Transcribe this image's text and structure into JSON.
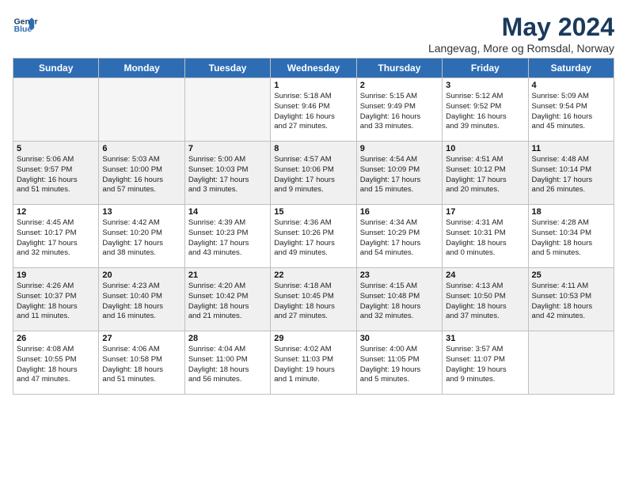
{
  "logo": {
    "line1": "General",
    "line2": "Blue"
  },
  "title": "May 2024",
  "subtitle": "Langevag, More og Romsdal, Norway",
  "days_of_week": [
    "Sunday",
    "Monday",
    "Tuesday",
    "Wednesday",
    "Thursday",
    "Friday",
    "Saturday"
  ],
  "weeks": [
    [
      {
        "num": "",
        "info": ""
      },
      {
        "num": "",
        "info": ""
      },
      {
        "num": "",
        "info": ""
      },
      {
        "num": "1",
        "info": "Sunrise: 5:18 AM\nSunset: 9:46 PM\nDaylight: 16 hours\nand 27 minutes."
      },
      {
        "num": "2",
        "info": "Sunrise: 5:15 AM\nSunset: 9:49 PM\nDaylight: 16 hours\nand 33 minutes."
      },
      {
        "num": "3",
        "info": "Sunrise: 5:12 AM\nSunset: 9:52 PM\nDaylight: 16 hours\nand 39 minutes."
      },
      {
        "num": "4",
        "info": "Sunrise: 5:09 AM\nSunset: 9:54 PM\nDaylight: 16 hours\nand 45 minutes."
      }
    ],
    [
      {
        "num": "5",
        "info": "Sunrise: 5:06 AM\nSunset: 9:57 PM\nDaylight: 16 hours\nand 51 minutes."
      },
      {
        "num": "6",
        "info": "Sunrise: 5:03 AM\nSunset: 10:00 PM\nDaylight: 16 hours\nand 57 minutes."
      },
      {
        "num": "7",
        "info": "Sunrise: 5:00 AM\nSunset: 10:03 PM\nDaylight: 17 hours\nand 3 minutes."
      },
      {
        "num": "8",
        "info": "Sunrise: 4:57 AM\nSunset: 10:06 PM\nDaylight: 17 hours\nand 9 minutes."
      },
      {
        "num": "9",
        "info": "Sunrise: 4:54 AM\nSunset: 10:09 PM\nDaylight: 17 hours\nand 15 minutes."
      },
      {
        "num": "10",
        "info": "Sunrise: 4:51 AM\nSunset: 10:12 PM\nDaylight: 17 hours\nand 20 minutes."
      },
      {
        "num": "11",
        "info": "Sunrise: 4:48 AM\nSunset: 10:14 PM\nDaylight: 17 hours\nand 26 minutes."
      }
    ],
    [
      {
        "num": "12",
        "info": "Sunrise: 4:45 AM\nSunset: 10:17 PM\nDaylight: 17 hours\nand 32 minutes."
      },
      {
        "num": "13",
        "info": "Sunrise: 4:42 AM\nSunset: 10:20 PM\nDaylight: 17 hours\nand 38 minutes."
      },
      {
        "num": "14",
        "info": "Sunrise: 4:39 AM\nSunset: 10:23 PM\nDaylight: 17 hours\nand 43 minutes."
      },
      {
        "num": "15",
        "info": "Sunrise: 4:36 AM\nSunset: 10:26 PM\nDaylight: 17 hours\nand 49 minutes."
      },
      {
        "num": "16",
        "info": "Sunrise: 4:34 AM\nSunset: 10:29 PM\nDaylight: 17 hours\nand 54 minutes."
      },
      {
        "num": "17",
        "info": "Sunrise: 4:31 AM\nSunset: 10:31 PM\nDaylight: 18 hours\nand 0 minutes."
      },
      {
        "num": "18",
        "info": "Sunrise: 4:28 AM\nSunset: 10:34 PM\nDaylight: 18 hours\nand 5 minutes."
      }
    ],
    [
      {
        "num": "19",
        "info": "Sunrise: 4:26 AM\nSunset: 10:37 PM\nDaylight: 18 hours\nand 11 minutes."
      },
      {
        "num": "20",
        "info": "Sunrise: 4:23 AM\nSunset: 10:40 PM\nDaylight: 18 hours\nand 16 minutes."
      },
      {
        "num": "21",
        "info": "Sunrise: 4:20 AM\nSunset: 10:42 PM\nDaylight: 18 hours\nand 21 minutes."
      },
      {
        "num": "22",
        "info": "Sunrise: 4:18 AM\nSunset: 10:45 PM\nDaylight: 18 hours\nand 27 minutes."
      },
      {
        "num": "23",
        "info": "Sunrise: 4:15 AM\nSunset: 10:48 PM\nDaylight: 18 hours\nand 32 minutes."
      },
      {
        "num": "24",
        "info": "Sunrise: 4:13 AM\nSunset: 10:50 PM\nDaylight: 18 hours\nand 37 minutes."
      },
      {
        "num": "25",
        "info": "Sunrise: 4:11 AM\nSunset: 10:53 PM\nDaylight: 18 hours\nand 42 minutes."
      }
    ],
    [
      {
        "num": "26",
        "info": "Sunrise: 4:08 AM\nSunset: 10:55 PM\nDaylight: 18 hours\nand 47 minutes."
      },
      {
        "num": "27",
        "info": "Sunrise: 4:06 AM\nSunset: 10:58 PM\nDaylight: 18 hours\nand 51 minutes."
      },
      {
        "num": "28",
        "info": "Sunrise: 4:04 AM\nSunset: 11:00 PM\nDaylight: 18 hours\nand 56 minutes."
      },
      {
        "num": "29",
        "info": "Sunrise: 4:02 AM\nSunset: 11:03 PM\nDaylight: 19 hours\nand 1 minute."
      },
      {
        "num": "30",
        "info": "Sunrise: 4:00 AM\nSunset: 11:05 PM\nDaylight: 19 hours\nand 5 minutes."
      },
      {
        "num": "31",
        "info": "Sunrise: 3:57 AM\nSunset: 11:07 PM\nDaylight: 19 hours\nand 9 minutes."
      },
      {
        "num": "",
        "info": ""
      }
    ]
  ]
}
